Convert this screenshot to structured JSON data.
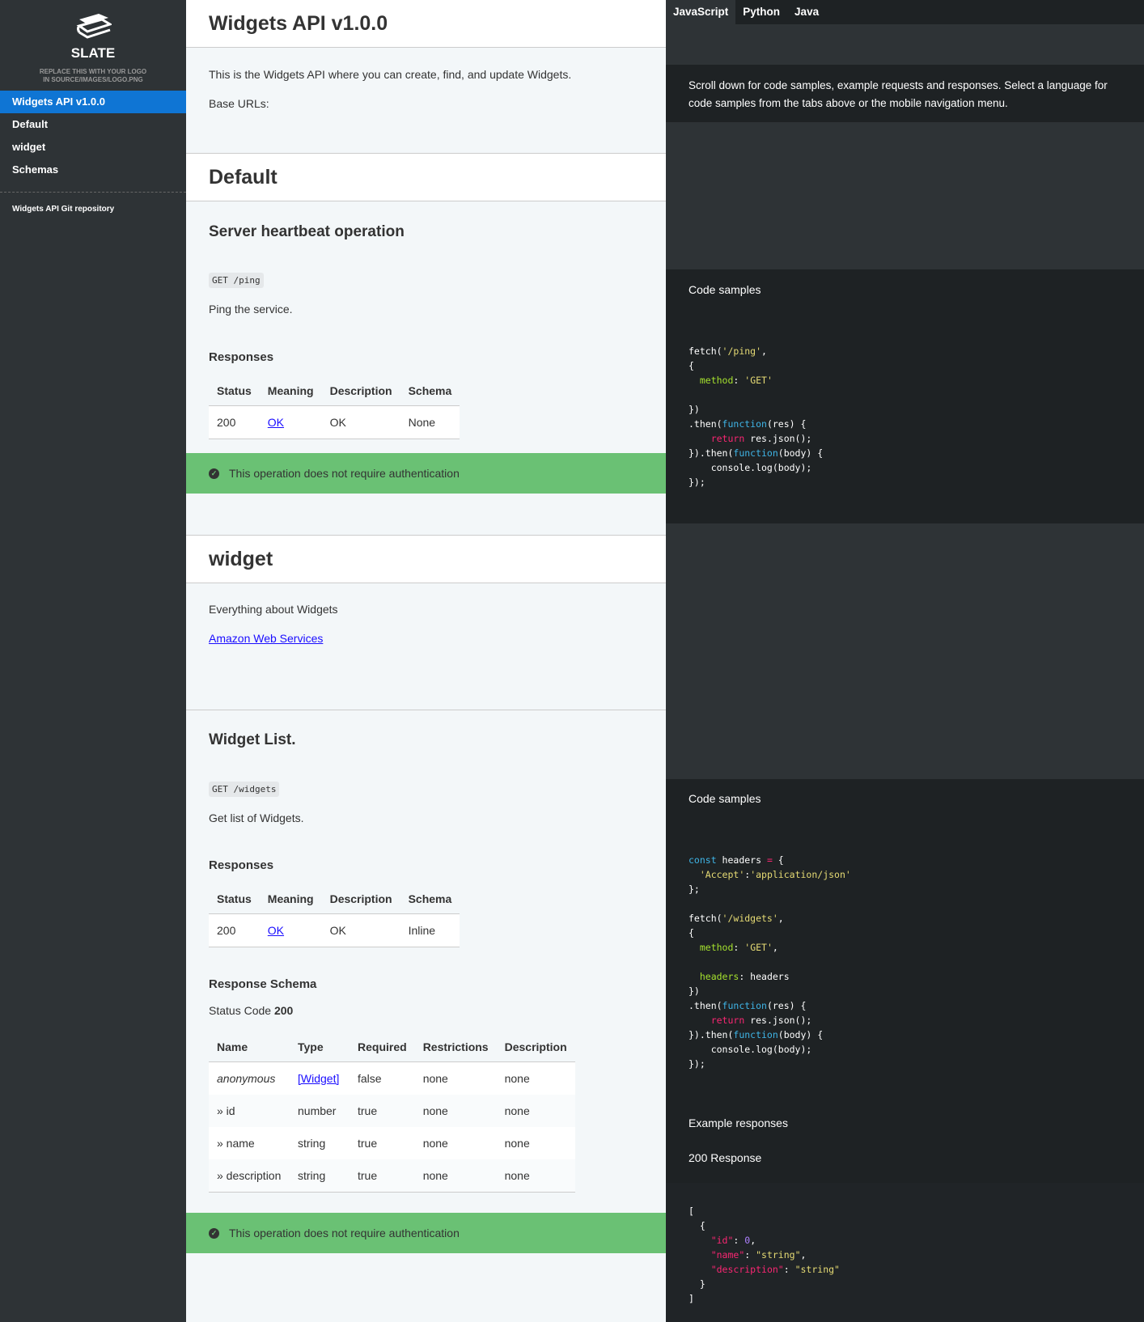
{
  "sidebar": {
    "logo_title": "SLATE",
    "logo_sub1": "REPLACE THIS WITH YOUR LOGO",
    "logo_sub2": "IN SOURCE/IMAGES/LOGO.PNG",
    "items": [
      {
        "label": "Widgets API v1.0.0"
      },
      {
        "label": "Default"
      },
      {
        "label": "widget"
      },
      {
        "label": "Schemas"
      }
    ],
    "footer_link": "Widgets API Git repository"
  },
  "main": {
    "title": "Widgets API v1.0.0",
    "intro": "This is the Widgets API where you can create, find, and update Widgets.",
    "base_urls": "Base URLs:",
    "default": {
      "heading": "Default",
      "op_title": "Server heartbeat operation",
      "endpoint": "GET /ping",
      "desc": "Ping the service.",
      "responses_heading": "Responses",
      "headers": [
        "Status",
        "Meaning",
        "Description",
        "Schema"
      ],
      "row": [
        "200",
        "OK",
        "OK",
        "None"
      ],
      "auth": "This operation does not require authentication"
    },
    "widget": {
      "heading": "widget",
      "desc": "Everything about Widgets",
      "link": "Amazon Web Services",
      "op_title": "Widget List.",
      "endpoint": "GET /widgets",
      "op_desc": "Get list of Widgets.",
      "responses_heading": "Responses",
      "headers": [
        "Status",
        "Meaning",
        "Description",
        "Schema"
      ],
      "row": [
        "200",
        "OK",
        "OK",
        "Inline"
      ],
      "schema_heading": "Response Schema",
      "status_code_label": "Status Code",
      "status_code": "200",
      "schema_headers": [
        "Name",
        "Type",
        "Required",
        "Restrictions",
        "Description"
      ],
      "schema_rows": [
        [
          "anonymous",
          "[Widget]",
          "false",
          "none",
          "none"
        ],
        [
          "» id",
          "number",
          "true",
          "none",
          "none"
        ],
        [
          "» name",
          "string",
          "true",
          "none",
          "none"
        ],
        [
          "» description",
          "string",
          "true",
          "none",
          "none"
        ]
      ],
      "auth": "This operation does not require authentication"
    }
  },
  "right": {
    "tabs": [
      "JavaScript",
      "Python",
      "Java"
    ],
    "intro": "Scroll down for code samples, example requests and responses. Select a language for code samples from the tabs above or the mobile navigation menu.",
    "code_samples_label": "Code samples",
    "example_responses_label": "Example responses",
    "response_200_label": "200 Response"
  },
  "colors": {
    "accent": "#0f75d4",
    "success": "#6ac174",
    "sidebar": "#2e3336",
    "code_bg": "#1e2224"
  }
}
